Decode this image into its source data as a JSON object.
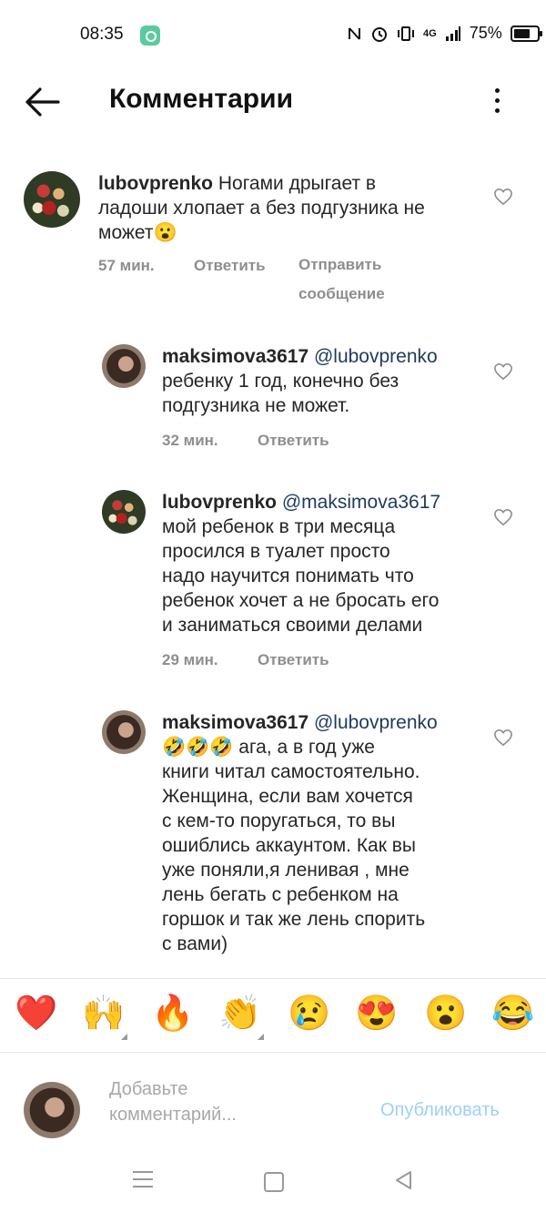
{
  "status_bar": {
    "time": "08:35",
    "icons": [
      "nfc-icon",
      "alarm-icon",
      "vibrate-icon",
      "4g-signal-icon"
    ],
    "network": "4G",
    "battery": "75%"
  },
  "header": {
    "title": "Комментарии",
    "back_icon": "back-arrow-icon",
    "more_icon": "more-vertical-icon"
  },
  "comments": [
    {
      "username": "lubovprenko",
      "mention": "",
      "text_lines": [
        "Ногами дрыгает в",
        "ладоши хлопает а без подгузника не",
        "может😮"
      ],
      "time": "57 мин.",
      "reply": "Ответить",
      "send": "Отправить",
      "send2": "сообщение"
    },
    {
      "username": "maksimova3617",
      "mention": "@lubovprenko",
      "text_lines": [
        "ребенку 1 год, конечно без",
        "подгузника не может."
      ],
      "time": "32 мин.",
      "reply": "Ответить"
    },
    {
      "username": "lubovprenko",
      "mention": "@maksimova3617",
      "text_lines": [
        "мой ребенок в три месяца",
        "просился в туалет просто",
        "надо научится понимать что",
        "ребенок хочет а не бросать его",
        "и заниматься своими делами"
      ],
      "time": "29 мин.",
      "reply": "Ответить"
    },
    {
      "username": "maksimova3617",
      "mention": "@lubovprenko",
      "text_lines": [
        "🤣🤣🤣 ага, а в год уже",
        "книги читал самостоятельно.",
        "Женщина, если вам хочется",
        "с кем-то поругаться, то вы",
        "ошиблись аккаунтом. Как вы",
        "уже поняли,я ленивая , мне",
        "лень бегать с ребенком на",
        "горшок и так же лень спорить",
        "с вами)"
      ]
    }
  ],
  "reactions": [
    "❤️",
    "🙌",
    "🔥",
    "👏",
    "😢",
    "😍",
    "😮",
    "😂"
  ],
  "composer": {
    "placeholder_line1": "Добавьте",
    "placeholder_line2": "комментарий...",
    "publish_label": "Опубликовать"
  },
  "nav": {
    "icons": [
      "menu-icon",
      "home-square-icon",
      "back-triangle-icon"
    ]
  },
  "colors": {
    "publish": "#9fd0f7",
    "mention": "#1f3a5e",
    "meta": "#8e8e8e"
  }
}
